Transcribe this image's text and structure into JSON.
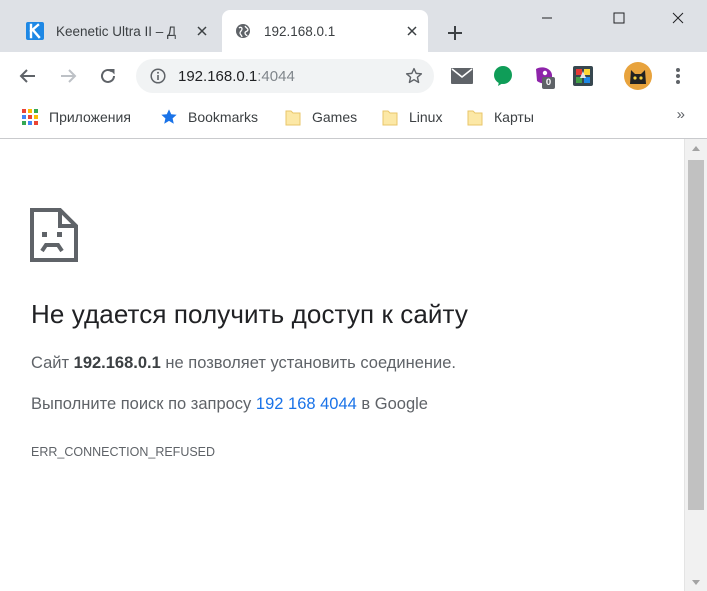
{
  "tabs": [
    {
      "title": "Keenetic Ultra II – Д",
      "favicon": "keenetic-logo-icon",
      "active": false
    },
    {
      "title": "192.168.0.1",
      "favicon": "globe-icon",
      "active": true
    }
  ],
  "toolbar": {
    "url_host": "192.168.0.1",
    "url_port": ":4044",
    "extension_badge": "0"
  },
  "bookmarks": {
    "items": [
      {
        "label": "Приложения",
        "icon": "apps-grid-icon"
      },
      {
        "label": "Bookmarks",
        "icon": "star-icon"
      },
      {
        "label": "Games",
        "icon": "folder-icon"
      },
      {
        "label": "Linux",
        "icon": "folder-icon"
      },
      {
        "label": "Карты",
        "icon": "folder-icon"
      }
    ],
    "more": "»"
  },
  "error": {
    "title": "Не удается получить доступ к сайту",
    "line1_prefix": "Сайт ",
    "line1_host": "192.168.0.1",
    "line1_suffix": " не позволяет установить соединение.",
    "line2_prefix": "Выполните поиск по запросу ",
    "line2_link": "192 168 4044",
    "line2_suffix": " в Google",
    "code": "ERR_CONNECTION_REFUSED"
  },
  "colors": {
    "titlebar": "#dee1e6",
    "link": "#1a73e8",
    "text": "#202124",
    "secondary_text": "#5f6368"
  }
}
